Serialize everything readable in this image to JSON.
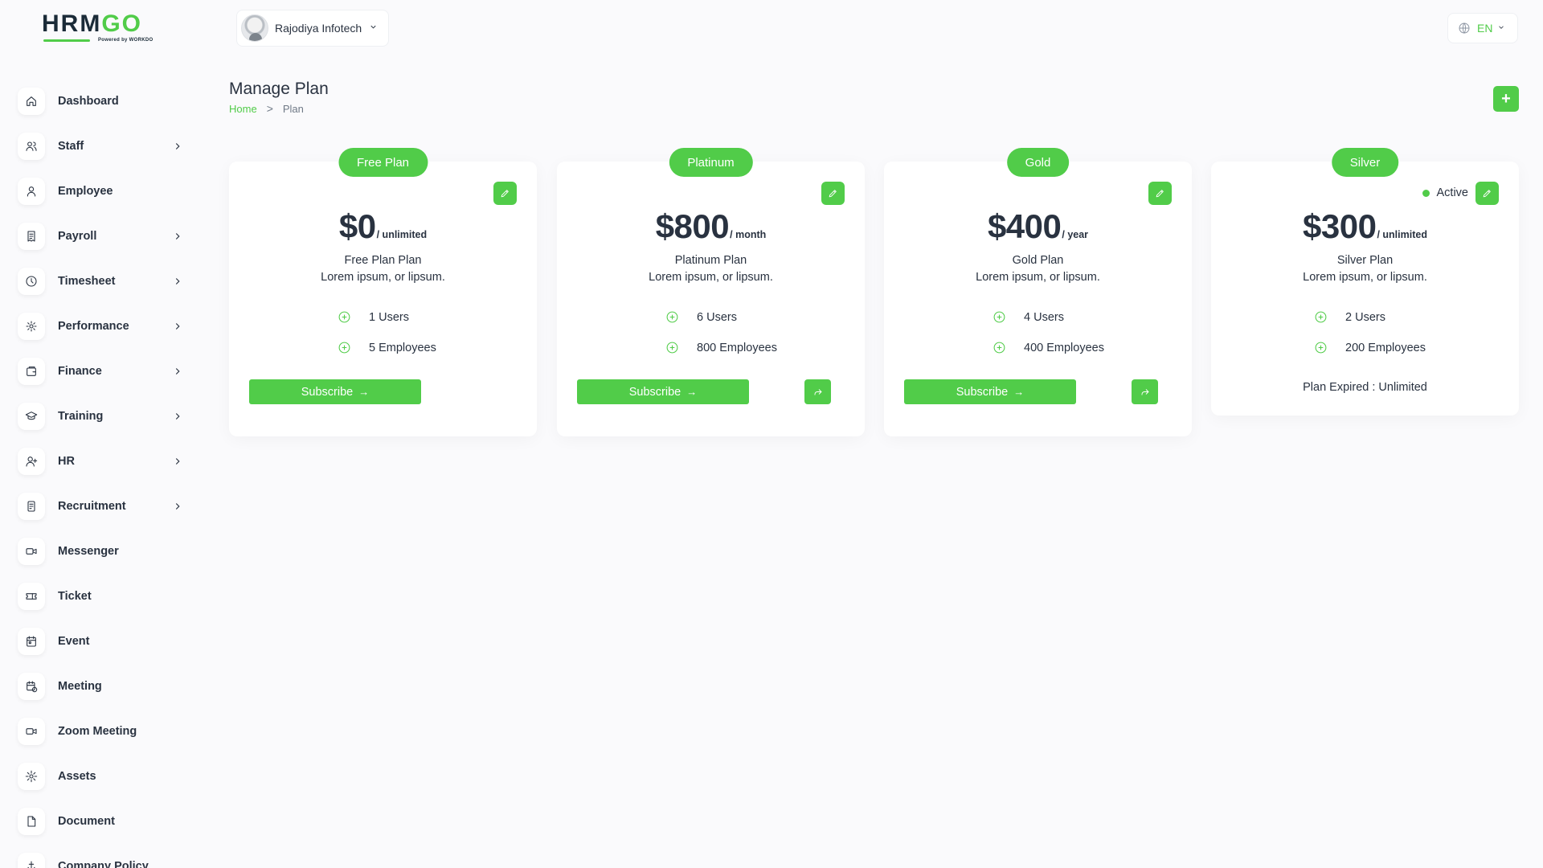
{
  "brand": {
    "logo_text_a": "HRM",
    "logo_text_b": "GO",
    "logo_sub": "Powered by WORKDO"
  },
  "header": {
    "company": "Rajodiya Infotech",
    "language": "EN"
  },
  "sidebar": {
    "items": [
      {
        "label": "Dashboard",
        "icon": "home-icon",
        "has_children": false
      },
      {
        "label": "Staff",
        "icon": "users-icon",
        "has_children": true
      },
      {
        "label": "Employee",
        "icon": "user-icon",
        "has_children": false
      },
      {
        "label": "Payroll",
        "icon": "receipt-icon",
        "has_children": true
      },
      {
        "label": "Timesheet",
        "icon": "clock-icon",
        "has_children": true
      },
      {
        "label": "Performance",
        "icon": "performance-icon",
        "has_children": true
      },
      {
        "label": "Finance",
        "icon": "wallet-icon",
        "has_children": true
      },
      {
        "label": "Training",
        "icon": "graduation-cap-icon",
        "has_children": true
      },
      {
        "label": "HR",
        "icon": "user-plus-icon",
        "has_children": true
      },
      {
        "label": "Recruitment",
        "icon": "recruitment-icon",
        "has_children": true
      },
      {
        "label": "Messenger",
        "icon": "video-icon",
        "has_children": false
      },
      {
        "label": "Ticket",
        "icon": "ticket-icon",
        "has_children": false
      },
      {
        "label": "Event",
        "icon": "calendar-event-icon",
        "has_children": false
      },
      {
        "label": "Meeting",
        "icon": "calendar-time-icon",
        "has_children": false
      },
      {
        "label": "Zoom Meeting",
        "icon": "video-icon",
        "has_children": false
      },
      {
        "label": "Assets",
        "icon": "assets-icon",
        "has_children": false
      },
      {
        "label": "Document",
        "icon": "file-icon",
        "has_children": false
      },
      {
        "label": "Company Policy",
        "icon": "policy-icon",
        "has_children": false
      }
    ]
  },
  "page": {
    "title": "Manage Plan",
    "breadcrumb_home": "Home",
    "breadcrumb_sep": ">",
    "breadcrumb_current": "Plan",
    "add_label": "+"
  },
  "plans": [
    {
      "badge": "Free Plan",
      "price": "$0",
      "period": "/ unlimited",
      "name": "Free Plan Plan",
      "desc": "Lorem ipsum, or lipsum.",
      "users": "1 Users",
      "employees": "5 Employees",
      "subscribe": "Subscribe",
      "arrow": "→"
    },
    {
      "badge": "Platinum",
      "price": "$800",
      "period": "/ month",
      "name": "Platinum Plan",
      "desc": "Lorem ipsum, or lipsum.",
      "users": "6 Users",
      "employees": "800 Employees",
      "subscribe": "Subscribe",
      "arrow": "→"
    },
    {
      "badge": "Gold",
      "price": "$400",
      "period": "/ year",
      "name": "Gold Plan",
      "desc": "Lorem ipsum, or lipsum.",
      "users": "4 Users",
      "employees": "400 Employees",
      "subscribe": "Subscribe",
      "arrow": "→"
    },
    {
      "badge": "Silver",
      "price": "$300",
      "period": "/ unlimited",
      "name": "Silver Plan",
      "desc": "Lorem ipsum, or lipsum.",
      "users": "2 Users",
      "employees": "200 Employees",
      "status": "Active",
      "expired": "Plan Expired : Unlimited"
    }
  ],
  "colors": {
    "accent": "#51cc49",
    "text": "#293240",
    "background": "#fafafc"
  }
}
